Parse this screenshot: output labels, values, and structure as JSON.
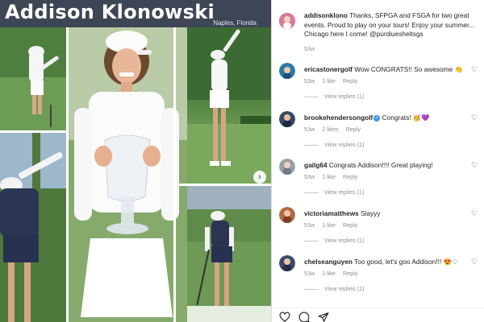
{
  "post": {
    "banner_title": "Addison Klonowski",
    "banner_location": "Naples, Florida"
  },
  "comments": [
    {
      "username": "addisonklono",
      "text": "Thanks, SFPGA and FSGA for two great events. Proud to play on your tours! Enjoy your summer... Chicago here I come! @purdiuesheltsgs",
      "time": "53w",
      "avatar_color": "#c04070"
    },
    {
      "username": "ericastonergolf",
      "text": "Wow CONGRATS!! So awesome",
      "emoji": "👏",
      "time": "53w",
      "likes": "1 like",
      "reply": "Reply",
      "view_replies": "View replies (1)",
      "avatar_color": "#2a7aa8"
    },
    {
      "username": "brookehendersongolf",
      "text": "Congrats!",
      "emoji": "🥳💜",
      "time": "53w",
      "likes": "2 likes",
      "reply": "Reply",
      "view_replies": "View replies (1)",
      "avatar_color": "#354a63"
    },
    {
      "username": "gailg64",
      "text": "Congrats Addison!!!! Great playing!",
      "time": "53w",
      "likes": "1 like",
      "reply": "Reply",
      "view_replies": "View replies (1)",
      "avatar_color": "#8a8f96"
    },
    {
      "username": "victoriamatthews",
      "text": "Slayyy",
      "time": "53w",
      "likes": "1 like",
      "reply": "Reply",
      "view_replies": "View replies (1)",
      "avatar_color": "#b06a42"
    },
    {
      "username": "chelseanguyen",
      "text": "Too good, let's goo Addison!!!",
      "emoji": "😍♡",
      "time": "53w",
      "likes": "1 like",
      "reply": "Reply",
      "view_replies": "View replies (1)",
      "avatar_color": "#3b4a6b"
    }
  ],
  "icons": {
    "like": "heart-icon",
    "comment": "comment-icon",
    "share": "share-icon",
    "next": "chevron-right-icon",
    "verified": "verified-badge-icon"
  },
  "colors": {
    "banner": "#3e4555",
    "link": "#00376b",
    "muted": "#8e8e8e",
    "verified": "#3897f0"
  }
}
